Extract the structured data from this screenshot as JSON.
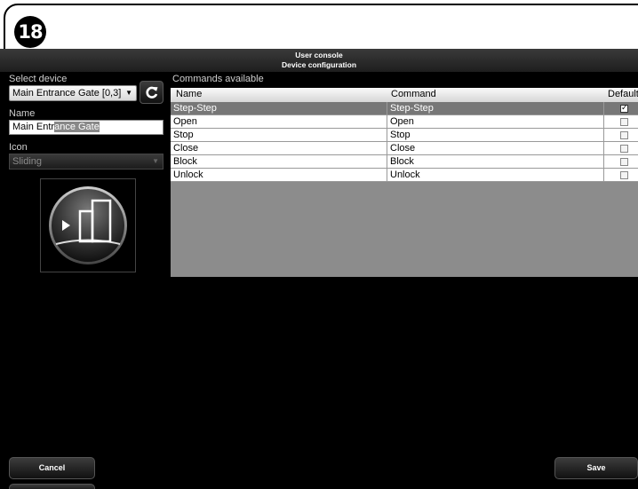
{
  "step_number": "18",
  "window": {
    "title": "User console",
    "subtitle": "Device configuration"
  },
  "left": {
    "select_device_label": "Select device",
    "selected_device": "Main Entrance Gate [0,3]",
    "name_label": "Name",
    "name_value_plain": "Main Entr",
    "name_value_selected": "ance Gate",
    "icon_label": "Icon",
    "icon_value": "Sliding"
  },
  "commands": {
    "section_label": "Commands available",
    "columns": [
      "Name",
      "Command",
      "Default"
    ],
    "rows": [
      {
        "name": "Step-Step",
        "command": "Step-Step",
        "default": true
      },
      {
        "name": "Open",
        "command": "Open",
        "default": false
      },
      {
        "name": "Stop",
        "command": "Stop",
        "default": false
      },
      {
        "name": "Close",
        "command": "Close",
        "default": false
      },
      {
        "name": "Block",
        "command": "Block",
        "default": false
      },
      {
        "name": "Unlock",
        "command": "Unlock",
        "default": false
      }
    ]
  },
  "buttons": {
    "cancel": "Cancel",
    "save": "Save"
  }
}
